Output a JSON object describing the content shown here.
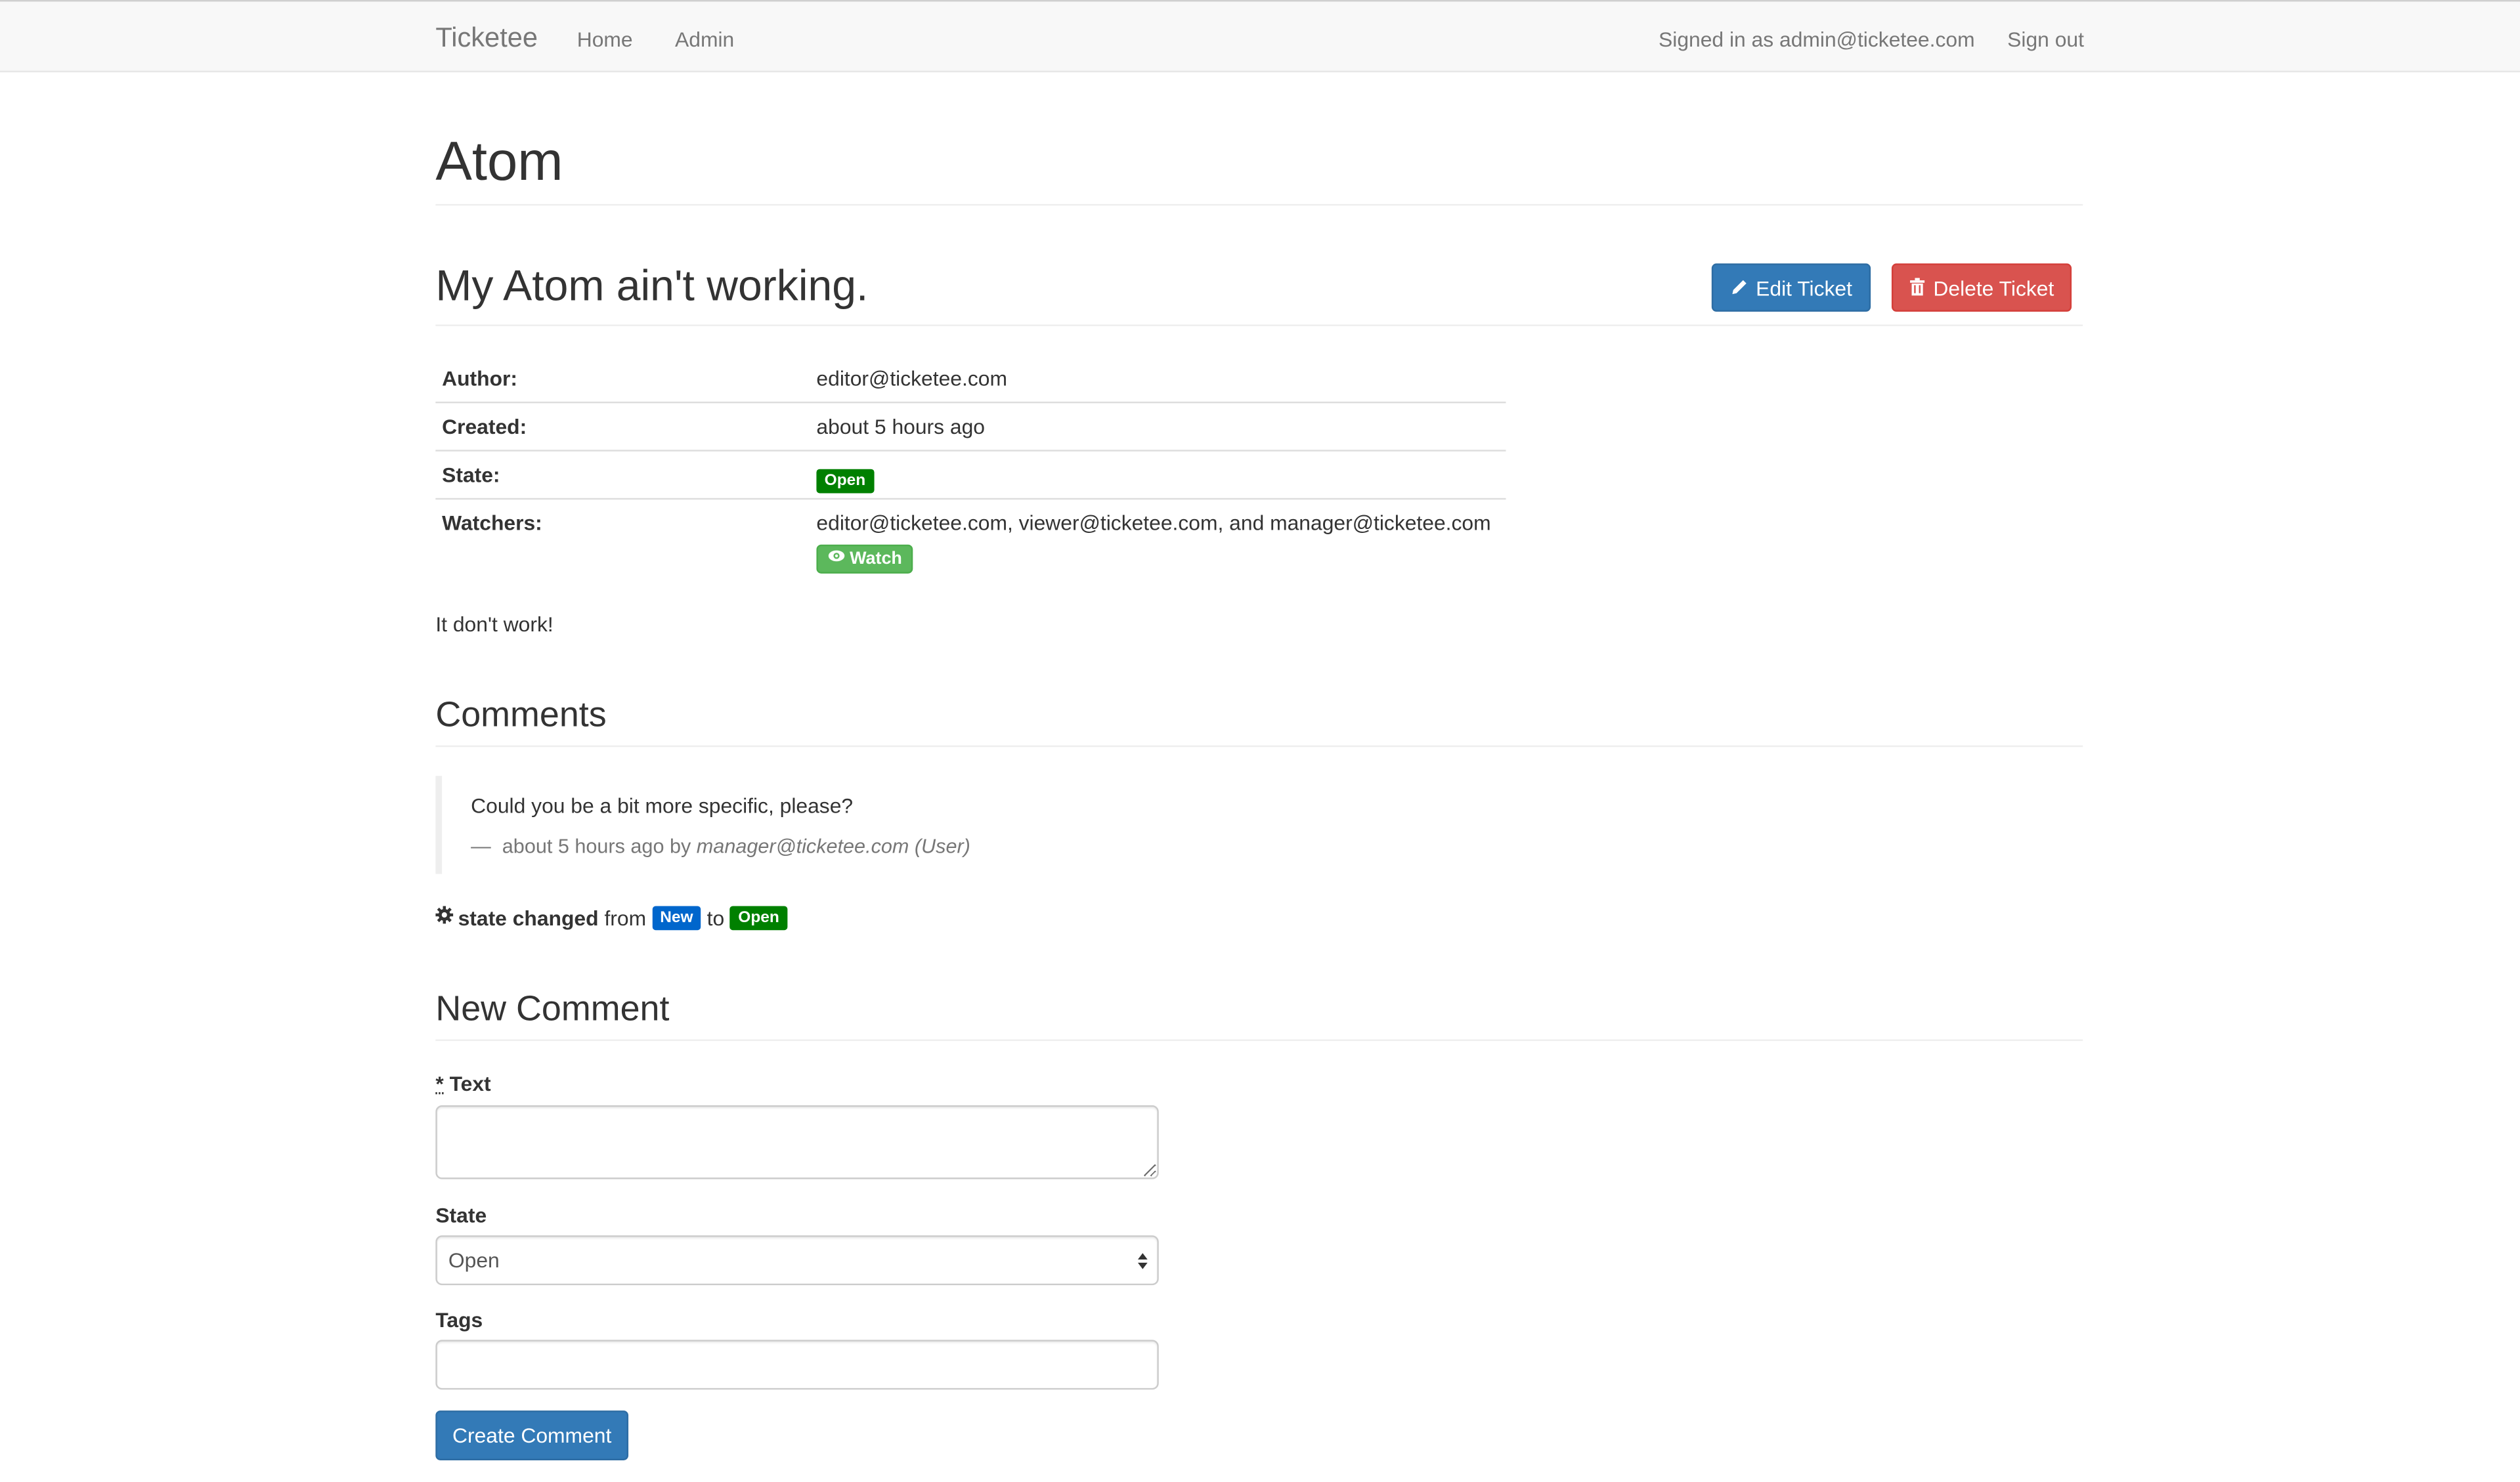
{
  "navbar": {
    "brand": "Ticketee",
    "links": [
      "Home",
      "Admin"
    ],
    "signed_in": "Signed in as admin@ticketee.com",
    "sign_out": "Sign out"
  },
  "project": {
    "title": "Atom"
  },
  "ticket": {
    "title": "My Atom ain't working.",
    "edit_label": "Edit Ticket",
    "delete_label": "Delete Ticket",
    "attributes": {
      "author_key": "Author:",
      "author_value": "editor@ticketee.com",
      "created_key": "Created:",
      "created_value": "about 5 hours ago",
      "state_key": "State:",
      "state_value": "Open",
      "watchers_key": "Watchers:",
      "watchers_value": "editor@ticketee.com, viewer@ticketee.com, and manager@ticketee.com",
      "watch_label": "Watch"
    },
    "description": "It don't work!"
  },
  "comments": {
    "heading": "Comments",
    "items": [
      {
        "text": "Could you be a bit more specific, please?",
        "dash": "—",
        "time": "about 5 hours ago by",
        "author": "manager@ticketee.com (User)"
      }
    ],
    "state_change": {
      "prefix": "state changed",
      "from_word": "from",
      "from_state": "New",
      "to_word": "to",
      "to_state": "Open"
    }
  },
  "new_comment": {
    "heading": "New Comment",
    "required_mark": "*",
    "text_label": "Text",
    "text_value": "",
    "state_label": "State",
    "state_value": "Open",
    "tags_label": "Tags",
    "tags_value": "",
    "submit_label": "Create Comment"
  },
  "colors": {
    "primary": "#337ab7",
    "danger": "#d9534f",
    "success": "#5cb85c",
    "state_open": "#008000",
    "state_new": "#0066cc"
  },
  "icons": {
    "edit": "pencil-icon",
    "delete": "trash-icon",
    "watch": "eye-icon",
    "state_change": "gear-icon",
    "select": "select-arrows-icon"
  }
}
